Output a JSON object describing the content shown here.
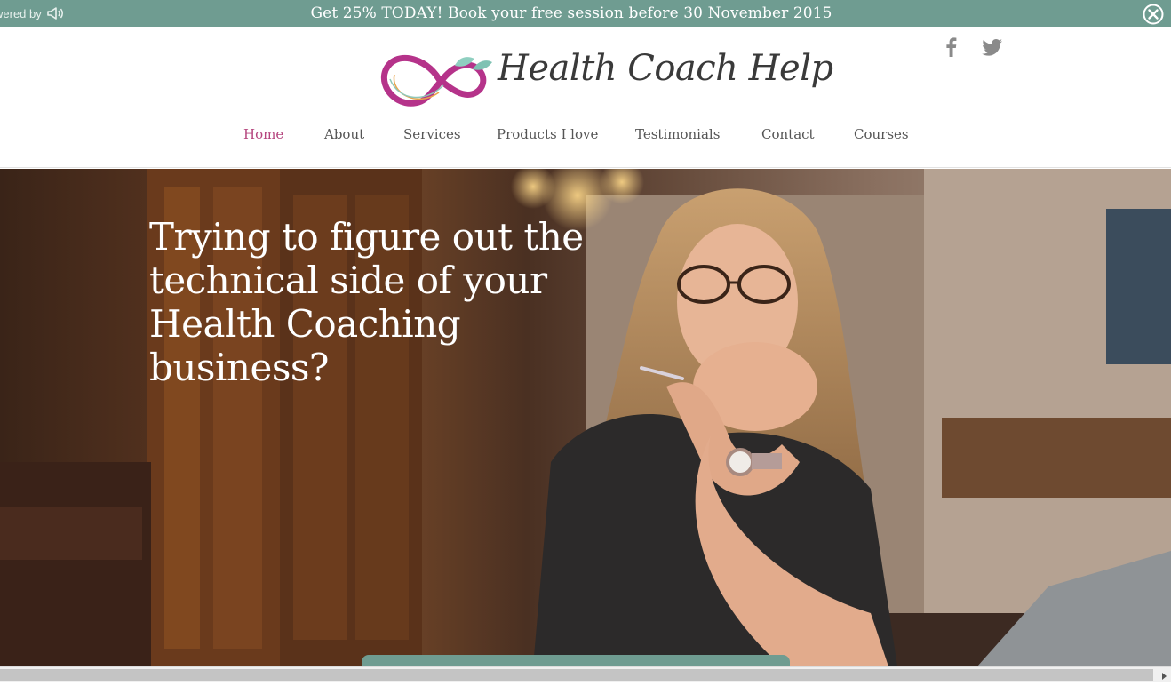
{
  "promo": {
    "powered_by": "wered by",
    "message": "Get 25% TODAY! Book your free session before 30 November 2015"
  },
  "brand": {
    "name": "Health Coach Help"
  },
  "nav": {
    "items": [
      {
        "label": "Home"
      },
      {
        "label": "About"
      },
      {
        "label": "Services"
      },
      {
        "label": "Products I love"
      },
      {
        "label": "Testimonials"
      },
      {
        "label": "Contact"
      },
      {
        "label": "Courses"
      }
    ],
    "active": "Home"
  },
  "hero": {
    "heading": "Trying to figure out the technical side of your Health Coaching business?"
  },
  "colors": {
    "promo_bar": "#6f9c91",
    "accent": "#b5457e",
    "nav_text": "#555555"
  },
  "icons": [
    "megaphone-icon",
    "close-icon",
    "facebook-icon",
    "twitter-icon",
    "scroll-right-arrow-icon"
  ]
}
